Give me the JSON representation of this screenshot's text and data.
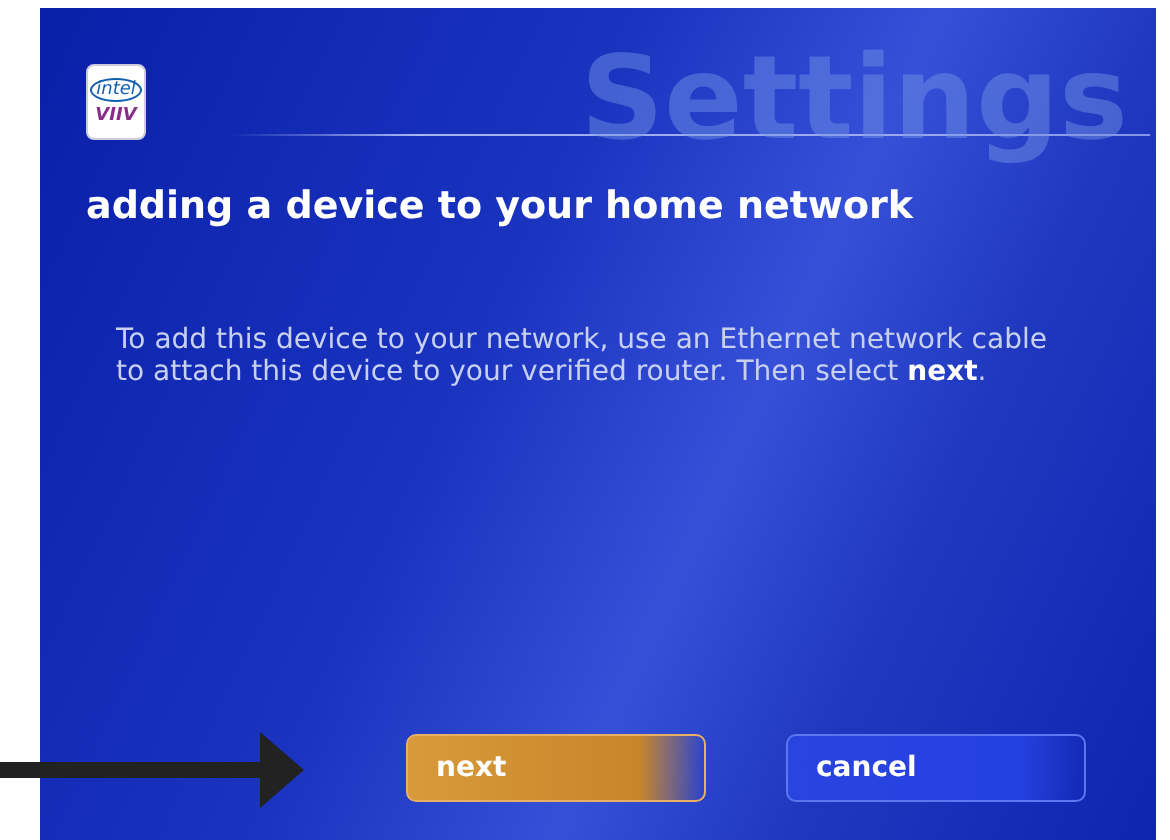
{
  "logo": {
    "top": "intel",
    "bottom": "VIIV"
  },
  "page_title": "Settings",
  "heading": "adding a device to your home network",
  "instructions": "To add this device to your network, use an Ethernet network cable to attach this device to your verified router. Then select **next**.",
  "buttons": [
    {
      "label": "next",
      "selected": true
    },
    {
      "label": "cancel",
      "selected": false
    }
  ],
  "pointer_arrow": true
}
